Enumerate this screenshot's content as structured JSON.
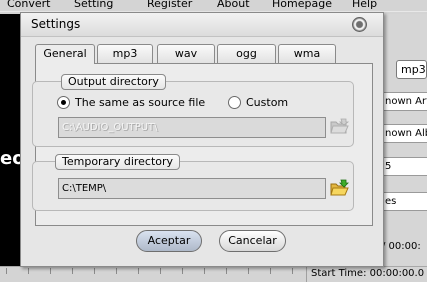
{
  "menu": {
    "items": [
      "Convert",
      "Setting",
      "Register",
      "About",
      "Homepage",
      "Help"
    ]
  },
  "background": {
    "video_text": "eo",
    "format_select": "mp3",
    "fields": [
      "nown Arti",
      "nown Alb",
      "5",
      "es"
    ],
    "time_display": "/ 00:00:",
    "start_time": "Start Time: 00:00:00.0"
  },
  "dialog": {
    "title": "Settings",
    "tabs": [
      "General",
      "mp3",
      "wav",
      "ogg",
      "wma"
    ],
    "active_tab": "General",
    "output_directory": {
      "label": "Output directory",
      "option_same": "The same as source file",
      "option_custom": "Custom",
      "selected": "The same as source file",
      "path": "C:\\AUDIO_OUTPUT\\"
    },
    "temporary_directory": {
      "label": "Temporary directory",
      "path": "C:\\TEMP\\"
    },
    "ok_label": "Aceptar",
    "cancel_label": "Cancelar"
  },
  "icons": [
    "close-icon",
    "folder-disabled-icon",
    "folder-open-icon",
    "radio-checked-icon",
    "radio-unchecked-icon"
  ]
}
